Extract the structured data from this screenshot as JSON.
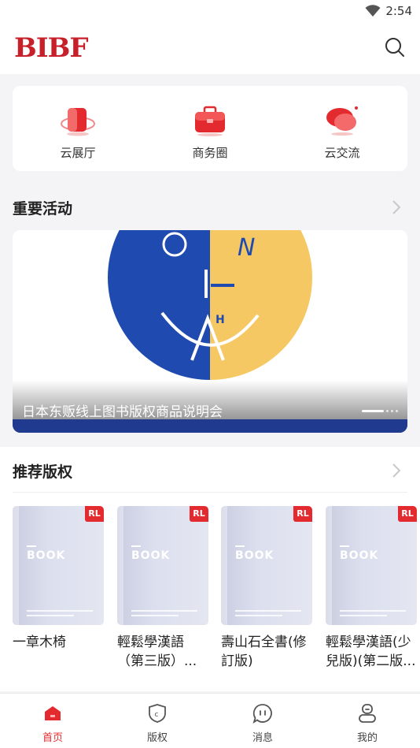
{
  "status": {
    "time": "2:54"
  },
  "header": {
    "logo_text": "BIBF"
  },
  "quick_links": [
    {
      "label": "云展厅",
      "icon": "cloud-hall-icon"
    },
    {
      "label": "商务圈",
      "icon": "briefcase-icon"
    },
    {
      "label": "云交流",
      "icon": "chat-bubble-icon"
    }
  ],
  "events": {
    "title": "重要活动",
    "banner_caption": "日本东贩线上图书版权商品说明会",
    "banner_image_letters": [
      "O",
      "N",
      "H",
      "A"
    ]
  },
  "recommended": {
    "title": "推荐版权",
    "cover_word": "BOOK",
    "badge": "RL",
    "books": [
      {
        "title": "一章木椅"
      },
      {
        "title": "輕鬆學漢語（第三版）..."
      },
      {
        "title": "壽山石全書(修訂版)"
      },
      {
        "title": "輕鬆學漢語(少兒版)(第二版..."
      }
    ]
  },
  "tabs": [
    {
      "label": "首页",
      "icon": "home-icon",
      "active": true
    },
    {
      "label": "版权",
      "icon": "copyright-shield-icon",
      "active": false
    },
    {
      "label": "消息",
      "icon": "message-icon",
      "active": false
    },
    {
      "label": "我的",
      "icon": "profile-icon",
      "active": false
    }
  ],
  "colors": {
    "brand_red": "#e32b2f",
    "banner_blue": "#1f4bb0",
    "banner_yellow": "#f6c864"
  }
}
